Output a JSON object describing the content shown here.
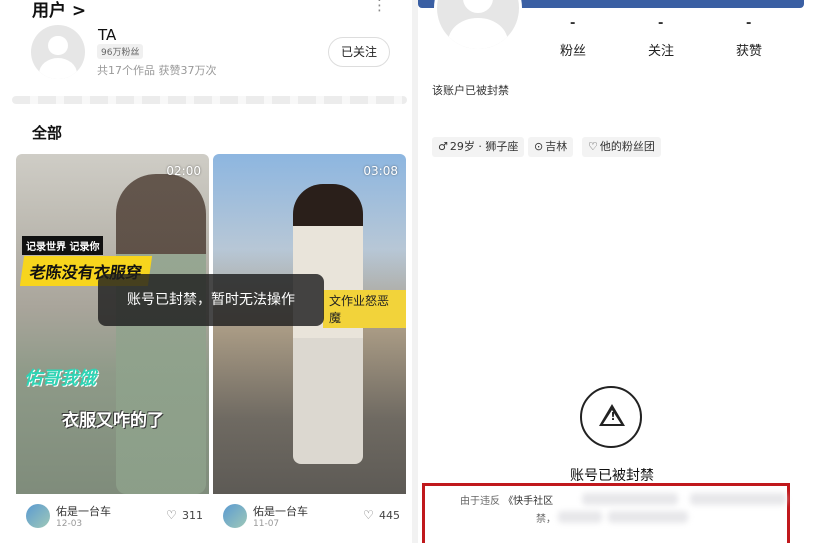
{
  "left": {
    "header_title": "用户 >",
    "more_icon": "⋮",
    "user": {
      "name": "TA",
      "fans_badge": "96万粉丝",
      "works_summary": "共17个作品 获赞37万次",
      "follow_label": "已关注"
    },
    "section_title": "全部",
    "videos": [
      {
        "duration": "02:00",
        "tag": "记录世界 记录你",
        "headline": "老陈没有衣服穿",
        "overlay_green": "佑哥我饿",
        "overlay_white": "衣服又咋的了",
        "author": "佑是一台车",
        "date": "12-03",
        "likes": "311"
      },
      {
        "duration": "03:08",
        "overlay_yellow": "文作业怒恶魔",
        "author": "佑是一台车",
        "date": "11-07",
        "likes": "445"
      }
    ],
    "toast": "账号已封禁，暂时无法操作"
  },
  "right": {
    "stats": [
      {
        "value": "-",
        "label": "粉丝"
      },
      {
        "value": "-",
        "label": "关注"
      },
      {
        "value": "-",
        "label": "获赞"
      }
    ],
    "banned_text": "该账户已被封禁",
    "chips": [
      {
        "icon": "♂",
        "text": "29岁 · 狮子座"
      },
      {
        "icon": "⊙",
        "text": "吉林"
      },
      {
        "icon": "♡",
        "text": "他的粉丝团"
      }
    ],
    "warning_title": "账号已被封禁",
    "notice_prefix": "由于违反",
    "notice_rule": "《快手社区",
    "notice_line2": "禁，"
  },
  "colors": {
    "accent_yellow": "#f7d51d",
    "highlight_red": "#c0181c",
    "banner_blue": "#3a5fa3"
  }
}
